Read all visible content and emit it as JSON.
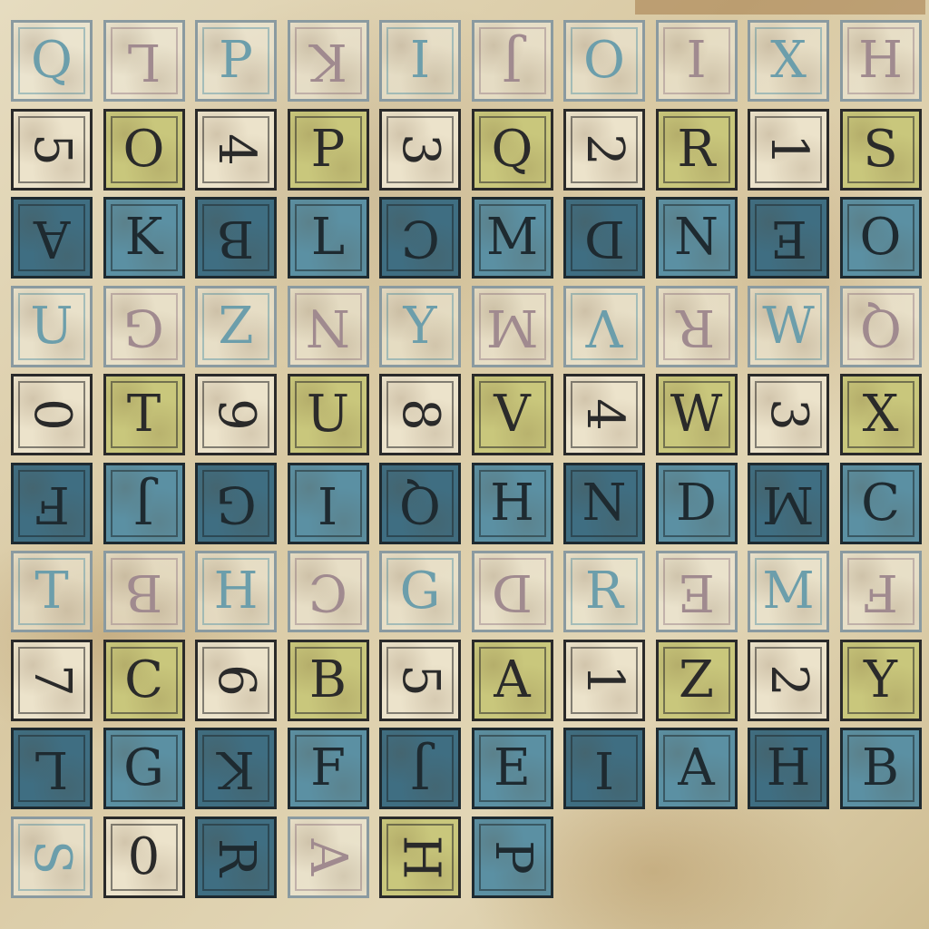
{
  "palette": {
    "paper": "#e2d6b6",
    "pale_tile": "#f0ecde",
    "cream_tile": "#ece3cb",
    "olive_tile": "#c9c77c",
    "teal_dark": "#3f6e82",
    "teal_mid": "#5b90a3",
    "ink_dark": "#2a2a2a",
    "ink_blue": "#6c9eab",
    "ink_mauve": "#a08a8f"
  },
  "rows": [
    {
      "style": "pale",
      "tiles": [
        {
          "char": "Q",
          "rot": 0,
          "ink": "blue"
        },
        {
          "char": "L",
          "rot": 180,
          "ink": "mauve"
        },
        {
          "char": "P",
          "rot": 0,
          "ink": "blue"
        },
        {
          "char": "K",
          "rot": 180,
          "ink": "mauve"
        },
        {
          "char": "I",
          "rot": 0,
          "ink": "blue"
        },
        {
          "char": "J",
          "rot": 180,
          "ink": "mauve"
        },
        {
          "char": "O",
          "rot": 0,
          "ink": "blue"
        },
        {
          "char": "I",
          "rot": 0,
          "ink": "mauve"
        },
        {
          "char": "X",
          "rot": 0,
          "ink": "blue"
        },
        {
          "char": "H",
          "rot": 0,
          "ink": "mauve"
        }
      ]
    },
    {
      "style": "cream",
      "tiles": [
        {
          "char": "5",
          "rot": 90,
          "kind": "cream"
        },
        {
          "char": "O",
          "rot": 0,
          "kind": "olive"
        },
        {
          "char": "4",
          "rot": 90,
          "kind": "cream"
        },
        {
          "char": "P",
          "rot": 0,
          "kind": "olive"
        },
        {
          "char": "3",
          "rot": 90,
          "kind": "cream"
        },
        {
          "char": "Q",
          "rot": 0,
          "kind": "olive"
        },
        {
          "char": "2",
          "rot": 90,
          "kind": "cream"
        },
        {
          "char": "R",
          "rot": 0,
          "kind": "olive"
        },
        {
          "char": "1",
          "rot": 90,
          "kind": "cream"
        },
        {
          "char": "S",
          "rot": 0,
          "kind": "olive"
        }
      ]
    },
    {
      "style": "dark",
      "tiles": [
        {
          "char": "A",
          "rot": 180,
          "kind": "dark"
        },
        {
          "char": "K",
          "rot": 0,
          "kind": "mid"
        },
        {
          "char": "B",
          "rot": 180,
          "kind": "dark"
        },
        {
          "char": "L",
          "rot": 0,
          "kind": "mid"
        },
        {
          "char": "C",
          "rot": 180,
          "kind": "dark"
        },
        {
          "char": "M",
          "rot": 0,
          "kind": "mid"
        },
        {
          "char": "D",
          "rot": 180,
          "kind": "dark"
        },
        {
          "char": "N",
          "rot": 0,
          "kind": "mid"
        },
        {
          "char": "E",
          "rot": 180,
          "kind": "dark"
        },
        {
          "char": "O",
          "rot": 0,
          "kind": "mid"
        }
      ]
    },
    {
      "style": "pale",
      "tiles": [
        {
          "char": "U",
          "rot": 0,
          "ink": "blue"
        },
        {
          "char": "G",
          "rot": 180,
          "ink": "mauve"
        },
        {
          "char": "Z",
          "rot": 0,
          "ink": "blue"
        },
        {
          "char": "N",
          "rot": 180,
          "ink": "mauve"
        },
        {
          "char": "Y",
          "rot": 0,
          "ink": "blue"
        },
        {
          "char": "M",
          "rot": 180,
          "ink": "mauve"
        },
        {
          "char": "V",
          "rot": 180,
          "ink": "blue"
        },
        {
          "char": "R",
          "rot": 180,
          "ink": "mauve"
        },
        {
          "char": "W",
          "rot": 0,
          "ink": "blue"
        },
        {
          "char": "Q",
          "rot": 180,
          "ink": "mauve"
        }
      ]
    },
    {
      "style": "cream",
      "tiles": [
        {
          "char": "0",
          "rot": 90,
          "kind": "cream"
        },
        {
          "char": "T",
          "rot": 0,
          "kind": "olive"
        },
        {
          "char": "9",
          "rot": 90,
          "kind": "cream"
        },
        {
          "char": "U",
          "rot": 0,
          "kind": "olive"
        },
        {
          "char": "8",
          "rot": 90,
          "kind": "cream"
        },
        {
          "char": "V",
          "rot": 0,
          "kind": "olive"
        },
        {
          "char": "4",
          "rot": 90,
          "kind": "cream"
        },
        {
          "char": "W",
          "rot": 0,
          "kind": "olive"
        },
        {
          "char": "3",
          "rot": 90,
          "kind": "cream"
        },
        {
          "char": "X",
          "rot": 0,
          "kind": "olive"
        }
      ]
    },
    {
      "style": "dark",
      "tiles": [
        {
          "char": "F",
          "rot": 180,
          "kind": "dark"
        },
        {
          "char": "J",
          "rot": 180,
          "kind": "mid"
        },
        {
          "char": "G",
          "rot": 180,
          "kind": "dark"
        },
        {
          "char": "I",
          "rot": 180,
          "kind": "mid"
        },
        {
          "char": "Q",
          "rot": 180,
          "kind": "dark"
        },
        {
          "char": "H",
          "rot": 0,
          "kind": "mid"
        },
        {
          "char": "N",
          "rot": 0,
          "kind": "dark"
        },
        {
          "char": "D",
          "rot": 0,
          "kind": "mid"
        },
        {
          "char": "M",
          "rot": 180,
          "kind": "dark"
        },
        {
          "char": "C",
          "rot": 0,
          "kind": "mid"
        }
      ]
    },
    {
      "style": "pale",
      "tiles": [
        {
          "char": "T",
          "rot": 0,
          "ink": "blue"
        },
        {
          "char": "B",
          "rot": 180,
          "ink": "mauve"
        },
        {
          "char": "H",
          "rot": 0,
          "ink": "blue"
        },
        {
          "char": "C",
          "rot": 180,
          "ink": "mauve"
        },
        {
          "char": "G",
          "rot": 0,
          "ink": "blue"
        },
        {
          "char": "D",
          "rot": 180,
          "ink": "mauve"
        },
        {
          "char": "R",
          "rot": 0,
          "ink": "blue"
        },
        {
          "char": "E",
          "rot": 180,
          "ink": "mauve"
        },
        {
          "char": "M",
          "rot": 0,
          "ink": "blue"
        },
        {
          "char": "F",
          "rot": 180,
          "ink": "mauve"
        }
      ]
    },
    {
      "style": "cream",
      "tiles": [
        {
          "char": "7",
          "rot": 90,
          "kind": "cream"
        },
        {
          "char": "C",
          "rot": 0,
          "kind": "olive"
        },
        {
          "char": "6",
          "rot": 90,
          "kind": "cream"
        },
        {
          "char": "B",
          "rot": 0,
          "kind": "olive"
        },
        {
          "char": "5",
          "rot": 90,
          "kind": "cream"
        },
        {
          "char": "A",
          "rot": 0,
          "kind": "olive"
        },
        {
          "char": "1",
          "rot": 90,
          "kind": "cream"
        },
        {
          "char": "Z",
          "rot": 0,
          "kind": "olive"
        },
        {
          "char": "2",
          "rot": 90,
          "kind": "cream"
        },
        {
          "char": "Y",
          "rot": 0,
          "kind": "olive"
        }
      ]
    },
    {
      "style": "dark",
      "tiles": [
        {
          "char": "L",
          "rot": 180,
          "kind": "dark"
        },
        {
          "char": "G",
          "rot": 0,
          "kind": "mid"
        },
        {
          "char": "K",
          "rot": 180,
          "kind": "dark"
        },
        {
          "char": "F",
          "rot": 0,
          "kind": "mid"
        },
        {
          "char": "J",
          "rot": 180,
          "kind": "dark"
        },
        {
          "char": "E",
          "rot": 0,
          "kind": "mid"
        },
        {
          "char": "I",
          "rot": 180,
          "kind": "dark"
        },
        {
          "char": "A",
          "rot": 0,
          "kind": "mid"
        },
        {
          "char": "H",
          "rot": 0,
          "kind": "dark"
        },
        {
          "char": "B",
          "rot": 0,
          "kind": "mid"
        }
      ]
    },
    {
      "style": "last",
      "tiles": [
        {
          "char": "S",
          "rot": 90,
          "kind": "pale",
          "ink": "blue"
        },
        {
          "char": "0",
          "rot": 0,
          "kind": "cream"
        },
        {
          "char": "R",
          "rot": 90,
          "kind": "dark"
        },
        {
          "char": "A",
          "rot": 90,
          "kind": "pale",
          "ink": "mauve"
        },
        {
          "char": "H",
          "rot": 90,
          "kind": "olive"
        },
        {
          "char": "P",
          "rot": 90,
          "kind": "mid"
        }
      ]
    }
  ]
}
